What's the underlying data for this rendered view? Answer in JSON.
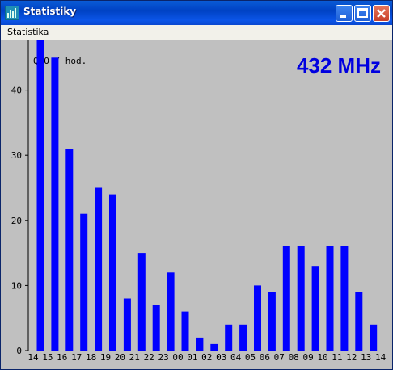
{
  "window": {
    "title": "Statistiky",
    "menu": [
      "Statistika"
    ]
  },
  "chart_data": {
    "type": "bar",
    "title": "432 MHz",
    "unit_label": "QSO / hod.",
    "categories": [
      "14",
      "15",
      "16",
      "17",
      "18",
      "19",
      "20",
      "21",
      "22",
      "23",
      "00",
      "01",
      "02",
      "03",
      "04",
      "05",
      "06",
      "07",
      "08",
      "09",
      "10",
      "11",
      "12",
      "13",
      "14"
    ],
    "values": [
      48,
      45,
      31,
      21,
      25,
      24,
      8,
      15,
      7,
      12,
      6,
      2,
      1,
      4,
      4,
      10,
      9,
      16,
      16,
      13,
      16,
      16,
      9,
      4
    ],
    "ylim": [
      0,
      48
    ],
    "yticks": [
      0,
      10,
      20,
      30,
      40
    ],
    "grid": false,
    "colors": {
      "bar": "#0000ff",
      "title": "#0000e0",
      "background": "#c0c0c0"
    }
  }
}
